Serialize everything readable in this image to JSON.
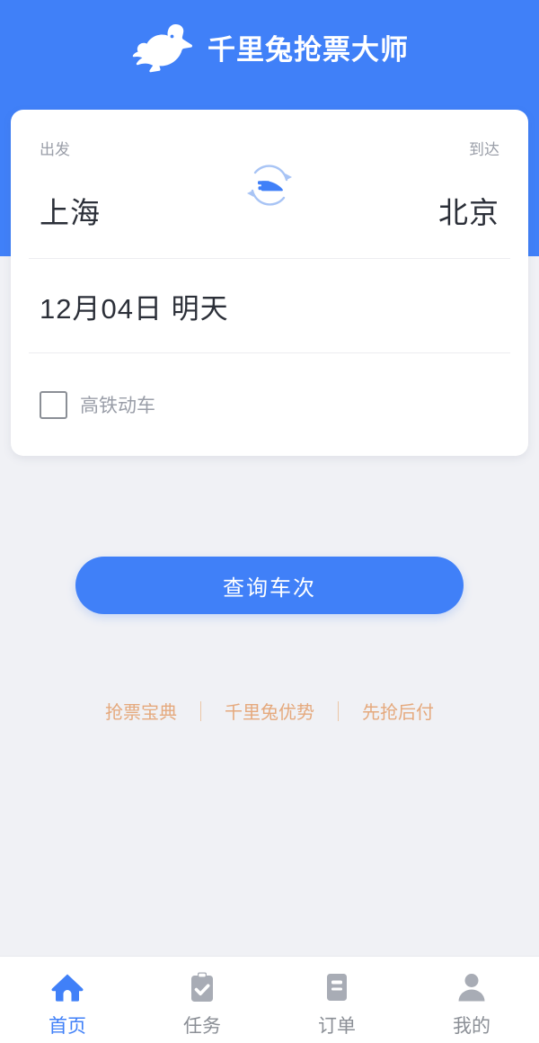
{
  "header": {
    "title": "千里兔抢票大师",
    "logo_icon": "rabbit-logo",
    "background_color": "#4080f8"
  },
  "search_card": {
    "departure_label": "出发",
    "departure_city": "上海",
    "arrival_label": "到达",
    "arrival_city": "北京",
    "swap_icon": "swap-train-icon",
    "date": "12月04日 明天",
    "option": {
      "label": "高铁动车",
      "checked": false
    }
  },
  "search_button": {
    "label": "查询车次",
    "color": "#4080f8"
  },
  "promo_links": {
    "color": "#e5a97d",
    "items": [
      {
        "label": "抢票宝典"
      },
      {
        "label": "千里兔优势"
      },
      {
        "label": "先抢后付"
      }
    ]
  },
  "tabbar": {
    "active_color": "#4080f8",
    "inactive_color": "#8b8f96",
    "items": [
      {
        "label": "首页",
        "icon": "home-icon",
        "active": true
      },
      {
        "label": "任务",
        "icon": "clipboard-check-icon",
        "active": false
      },
      {
        "label": "订单",
        "icon": "order-document-icon",
        "active": false
      },
      {
        "label": "我的",
        "icon": "person-icon",
        "active": false
      }
    ]
  }
}
